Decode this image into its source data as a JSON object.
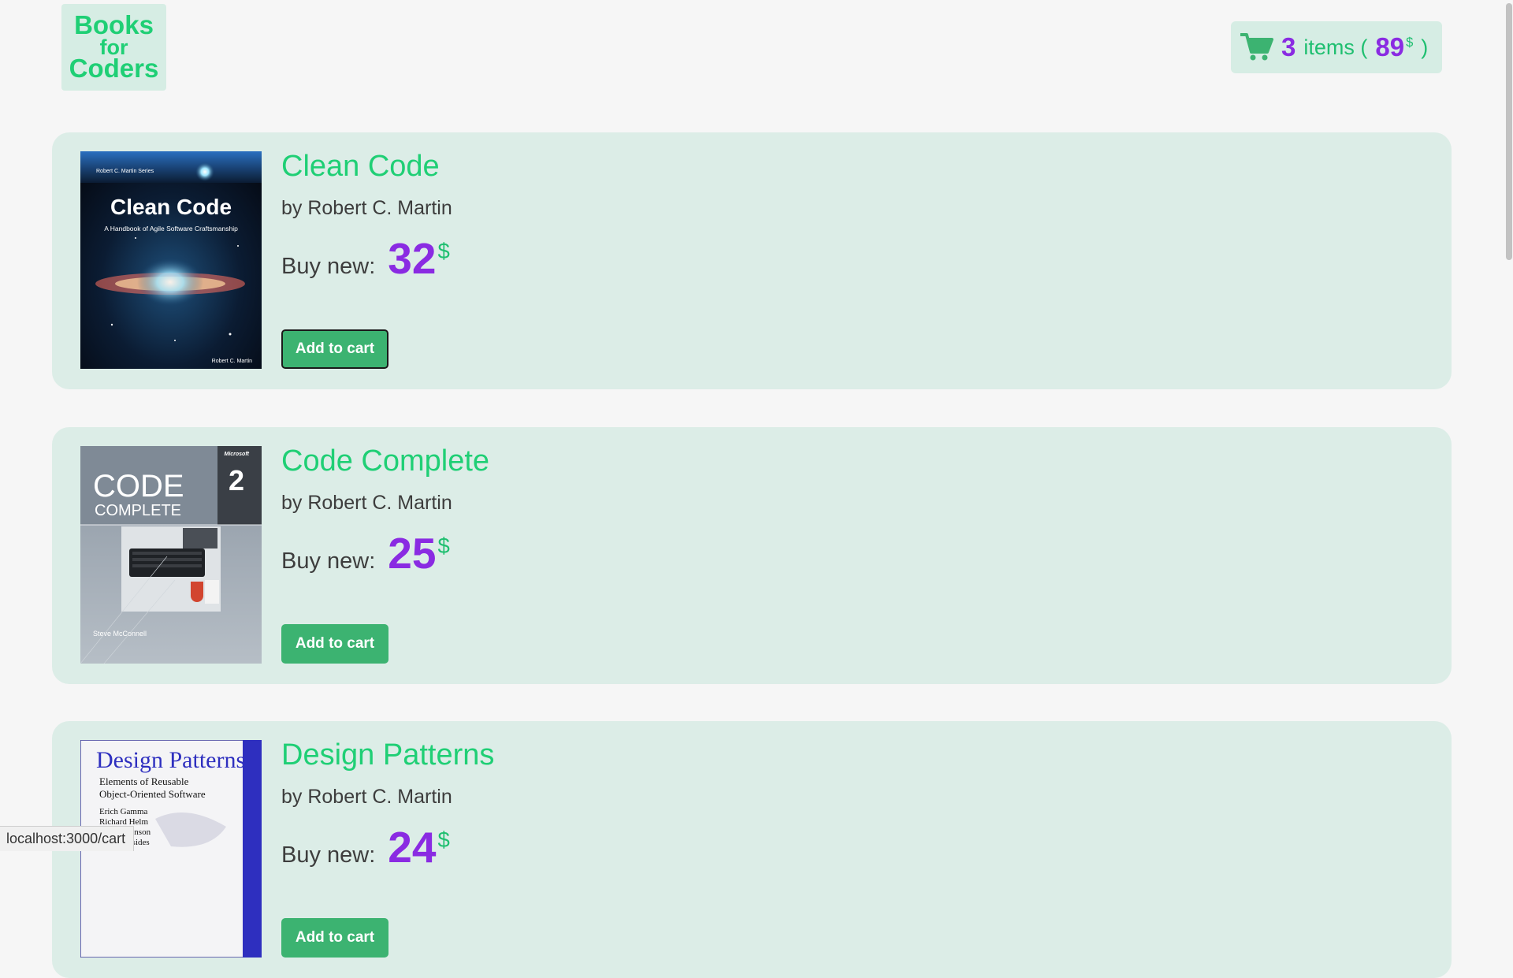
{
  "logo": {
    "line1": "Books",
    "line2": "for",
    "line3": "Coders"
  },
  "cart": {
    "count": "3",
    "items_text": "items (",
    "total": "89",
    "currency": "$",
    "close_paren": ")",
    "icon": "shopping-cart-icon"
  },
  "books": [
    {
      "title": "Clean Code",
      "author": "by Robert C. Martin",
      "price_label": "Buy new:",
      "price": "32",
      "currency": "$",
      "button": "Add to cart",
      "cover": {
        "series": "Robert C. Martin Series",
        "title": "Clean Code",
        "subtitle": "A Handbook of Agile Software Craftsmanship",
        "author": "Robert C. Martin"
      }
    },
    {
      "title": "Code Complete",
      "author": "by Robert C. Martin",
      "price_label": "Buy new:",
      "price": "25",
      "currency": "$",
      "button": "Add to cart",
      "cover": {
        "brand": "Microsoft",
        "title": "CODE",
        "subtitle": "COMPLETE",
        "edition": "2",
        "author": "Steve McConnell"
      }
    },
    {
      "title": "Design Patterns",
      "author": "by Robert C. Martin",
      "price_label": "Buy new:",
      "price": "24",
      "currency": "$",
      "button": "Add to cart",
      "cover": {
        "title": "Design Patterns",
        "subtitle_line1": "Elements of Reusable",
        "subtitle_line2": "Object-Oriented Software",
        "authors": [
          "Erich Gamma",
          "Richard Helm",
          "Ralph Johnson",
          "John Vlissides"
        ]
      }
    }
  ],
  "status_bar": {
    "url": "localhost:3000/cart"
  },
  "colors": {
    "accent_green": "#1fcf75",
    "button_green": "#3cb371",
    "price_purple": "#8a2be2",
    "card_bg": "#dcede7"
  }
}
